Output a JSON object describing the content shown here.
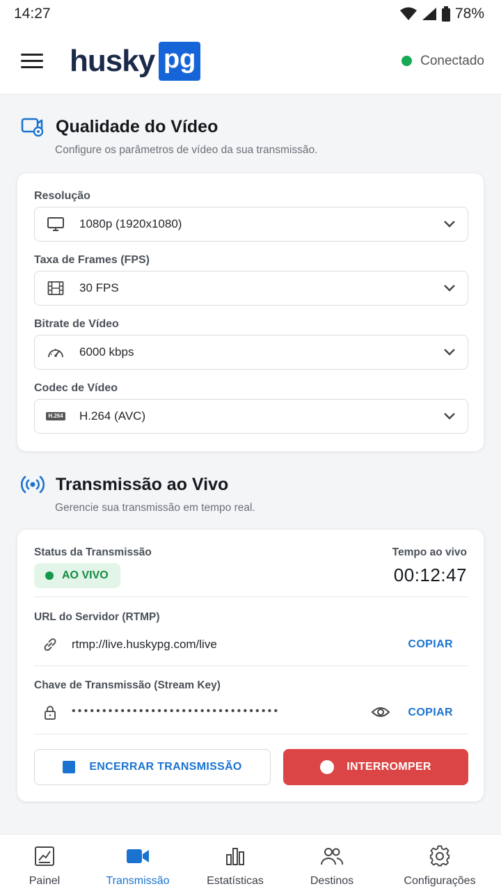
{
  "status_bar": {
    "time": "14:27",
    "battery": "78%"
  },
  "header": {
    "logo_text": "husky",
    "logo_box": "pg",
    "connection_status": "Conectado",
    "connection_color": "#18a957"
  },
  "video_quality": {
    "title": "Qualidade do Vídeo",
    "subtitle": "Configure os parâmetros de vídeo da sua transmissão.",
    "fields": [
      {
        "label": "Resolução",
        "value": "1080p (1920x1080)",
        "icon": "monitor-icon"
      },
      {
        "label": "Taxa de Frames (FPS)",
        "value": "30 FPS",
        "icon": "film-icon"
      },
      {
        "label": "Bitrate de Vídeo",
        "value": "6000 kbps",
        "icon": "speedometer-icon"
      },
      {
        "label": "Codec de Vídeo",
        "value": "H.264 (AVC)",
        "icon": "codec-badge-icon",
        "icon_text": "H.264"
      }
    ]
  },
  "live": {
    "title": "Transmissão ao Vivo",
    "subtitle": "Gerencie sua transmissão em tempo real.",
    "status_label": "Status da Transmissão",
    "status_value": "AO VIVO",
    "time_label": "Tempo ao vivo",
    "time_value": "00:12:47",
    "server_label": "URL do Servidor (RTMP)",
    "server_url": "rtmp://live.huskypg.com/live",
    "key_label": "Chave de Transmissão (Stream Key)",
    "key_masked": "••••••••••••••••••••••••••••••••••",
    "copy_label": "COPIAR",
    "end_button": "ENCERRAR TRANSMISSÃO",
    "stop_button": "INTERROMPER",
    "accent_color": "#1a73d0",
    "stop_color": "#dc4545"
  },
  "bottom_nav": [
    {
      "label": "Painel",
      "icon": "dashboard-icon",
      "active": false
    },
    {
      "label": "Transmissão",
      "icon": "video-camera-icon",
      "active": true
    },
    {
      "label": "Estatísticas",
      "icon": "bar-chart-icon",
      "active": false
    },
    {
      "label": "Destinos",
      "icon": "users-icon",
      "active": false
    },
    {
      "label": "Configurações",
      "icon": "gear-icon",
      "active": false
    }
  ]
}
